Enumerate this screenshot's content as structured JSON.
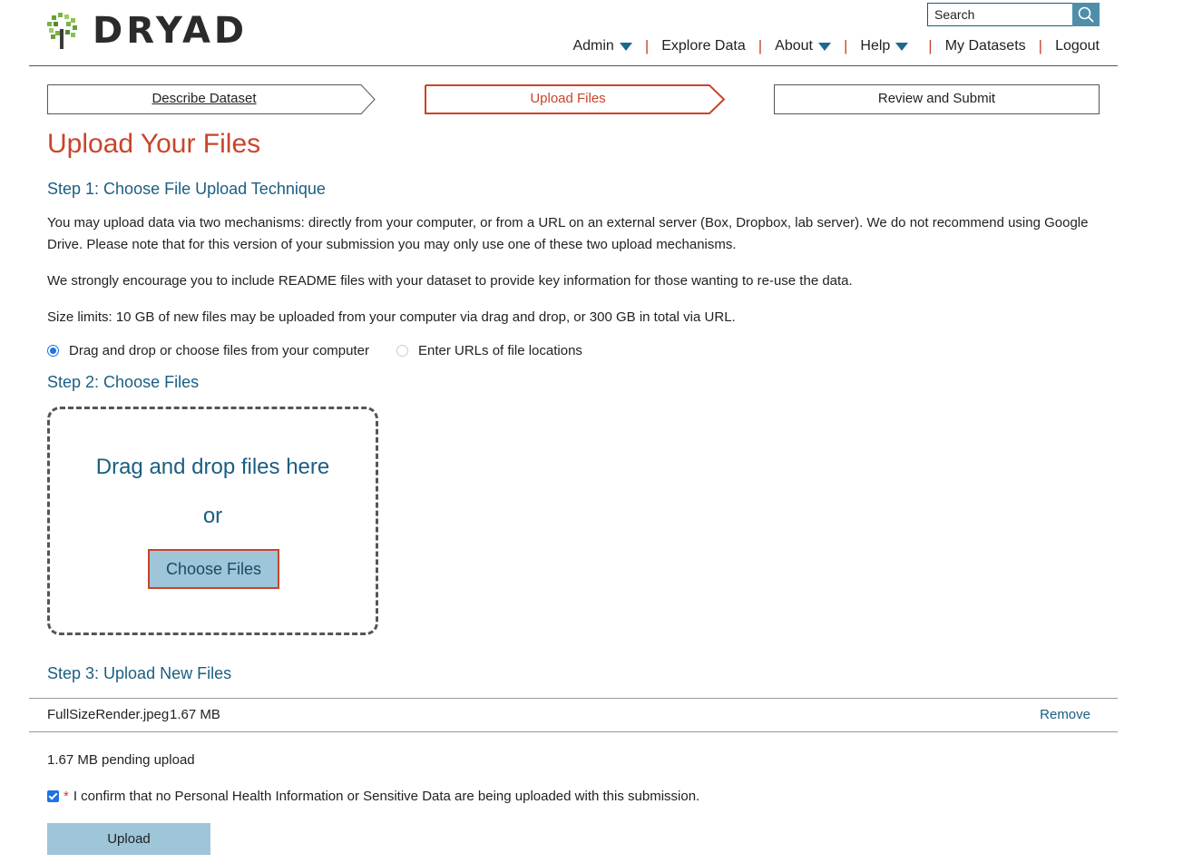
{
  "brand": {
    "name": "DRYAD",
    "accent": "#c8452a",
    "link_color": "#1a5e82"
  },
  "search": {
    "placeholder": "Search",
    "value": "Search",
    "icon": "search-icon"
  },
  "nav": {
    "items": [
      {
        "label": "Admin",
        "dropdown": true
      },
      {
        "label": "Explore Data",
        "dropdown": false
      },
      {
        "label": "About",
        "dropdown": true
      },
      {
        "label": "Help",
        "dropdown": true
      },
      {
        "label": "My Datasets",
        "dropdown": false
      },
      {
        "label": "Logout",
        "dropdown": false
      }
    ]
  },
  "steps": [
    {
      "label": "Describe Dataset",
      "state": "done"
    },
    {
      "label": "Upload Files",
      "state": "active"
    },
    {
      "label": "Review and Submit",
      "state": "pending"
    }
  ],
  "main": {
    "title": "Upload Your Files",
    "step1_heading": "Step 1: Choose File Upload Technique",
    "para1": "You may upload data via two mechanisms: directly from your computer, or from a URL on an external server (Box, Dropbox, lab server). We do not recommend using Google Drive. Please note that for this version of your submission you may only use one of these two upload mechanisms.",
    "para2": "We strongly encourage you to include README files with your dataset to provide key information for those wanting to re-use the data.",
    "para3": "Size limits: 10 GB of new files may be uploaded from your computer via drag and drop, or 300 GB in total via URL.",
    "radio_options": [
      {
        "label": "Drag and drop or choose files from your computer",
        "selected": true
      },
      {
        "label": "Enter URLs of file locations",
        "selected": false
      }
    ],
    "step2_heading": "Step 2: Choose Files",
    "dropzone": {
      "text": "Drag and drop files here",
      "or": "or",
      "button": "Choose Files"
    },
    "step3_heading": "Step 3: Upload New Files",
    "files": [
      {
        "name": "FullSizeRender.jpeg",
        "size": "1.67 MB",
        "action": "Remove"
      }
    ],
    "pending": "1.67 MB pending upload",
    "confirm": {
      "required_mark": "*",
      "text": "I confirm that no Personal Health Information or Sensitive Data are being uploaded with this submission.",
      "checked": true
    },
    "upload_button": "Upload"
  }
}
